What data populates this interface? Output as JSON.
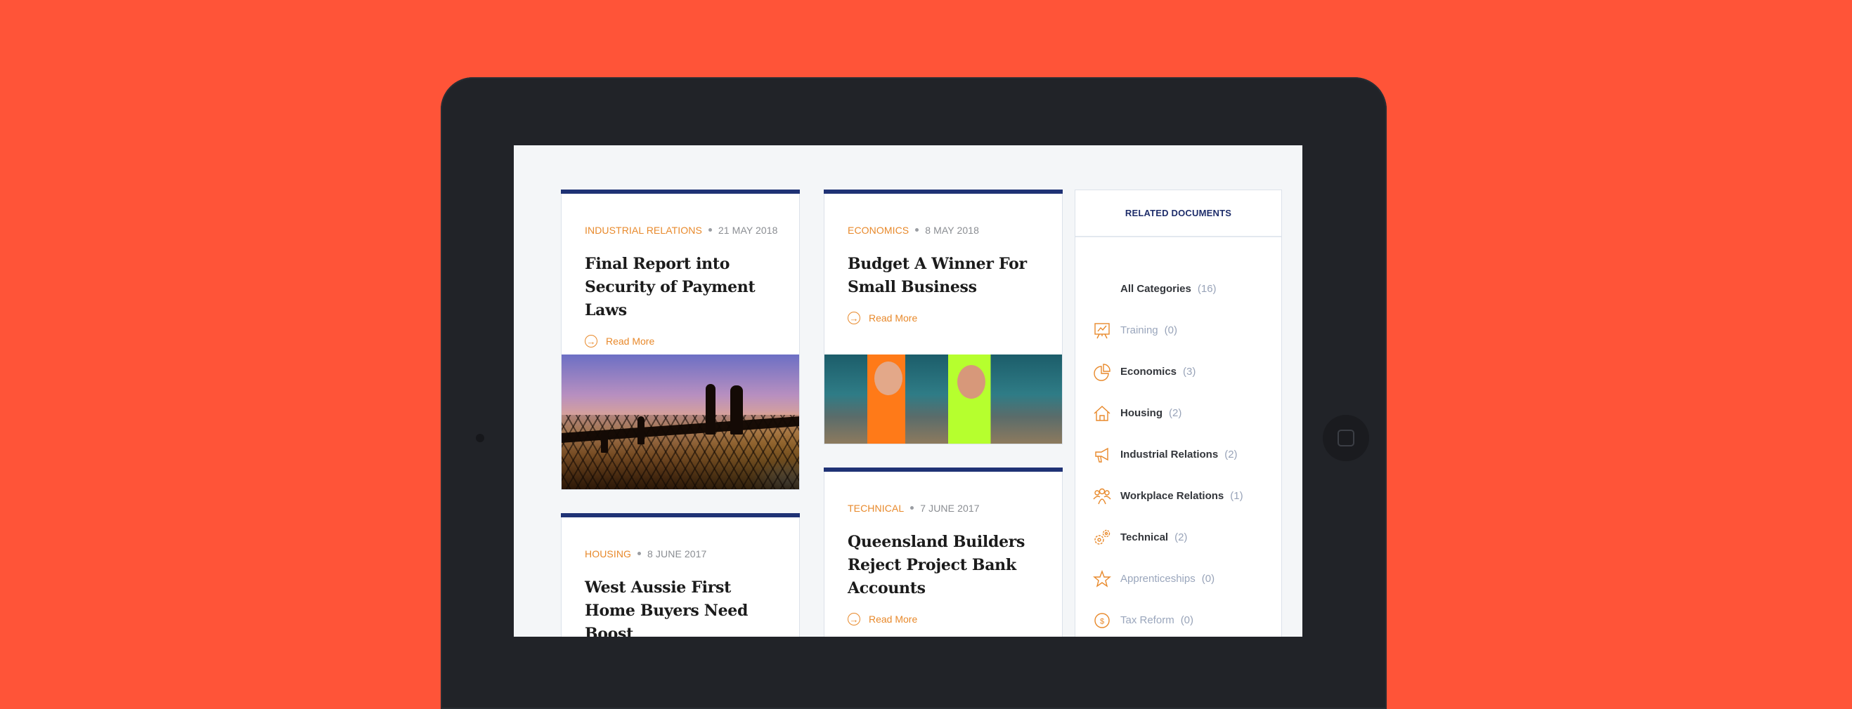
{
  "colors": {
    "background": "#FF5438",
    "tablet": "#212328",
    "accent_orange": "#E8892B",
    "navy": "#1F3275"
  },
  "cards": [
    {
      "category": "INDUSTRIAL RELATIONS",
      "date": "21 MAY 2018",
      "title": "Final Report into Security of Payment Laws",
      "read_more": "Read More",
      "image": "construction-workers-silhouette"
    },
    {
      "category": "ECONOMICS",
      "date": "8 MAY 2018",
      "title": "Budget A Winner For Small Business",
      "read_more": "Read More",
      "image": "handshake-workers"
    },
    {
      "category": "TECHNICAL",
      "date": "7 JUNE 2017",
      "title": "Queensland Builders Reject Project Bank Accounts",
      "read_more": "Read More"
    },
    {
      "category": "HOUSING",
      "date": "8 JUNE 2017",
      "title": "West Aussie First Home Buyers Need Boost"
    }
  ],
  "sidebar": {
    "title": "RELATED DOCUMENTS",
    "categories": [
      {
        "label": "All Categories",
        "count": "(16)",
        "icon": null
      },
      {
        "label": "Training",
        "count": "(0)",
        "icon": "presentation-chart-icon"
      },
      {
        "label": "Economics",
        "count": "(3)",
        "icon": "pie-chart-icon"
      },
      {
        "label": "Housing",
        "count": "(2)",
        "icon": "house-icon"
      },
      {
        "label": "Industrial Relations",
        "count": "(2)",
        "icon": "megaphone-icon"
      },
      {
        "label": "Workplace Relations",
        "count": "(1)",
        "icon": "people-group-icon"
      },
      {
        "label": "Technical",
        "count": "(2)",
        "icon": "gears-icon"
      },
      {
        "label": "Apprenticeships",
        "count": "(0)",
        "icon": "star-icon"
      },
      {
        "label": "Tax Reform",
        "count": "(0)",
        "icon": "dollar-coin-icon"
      }
    ]
  }
}
